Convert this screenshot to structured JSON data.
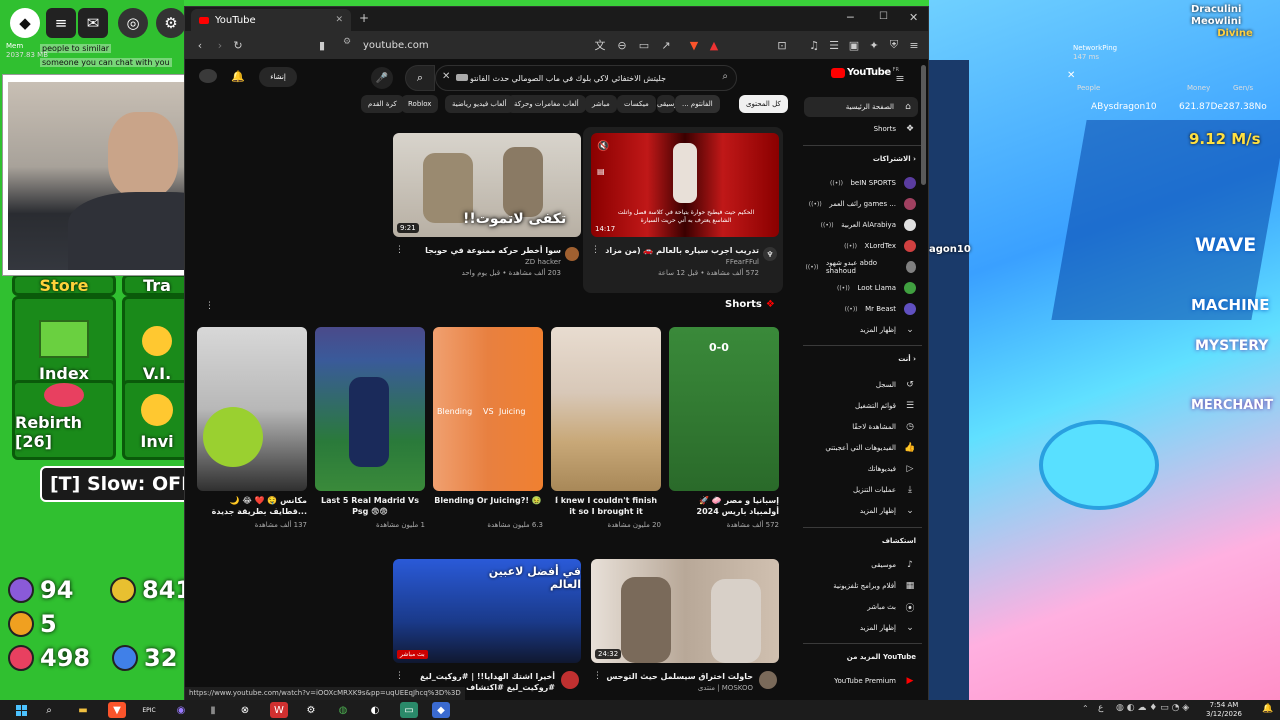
{
  "game": {
    "mem_label": "Mem",
    "mem_value": "2037.83 MB",
    "network_label": "NetworkPing",
    "network_value": "147 ms",
    "chat_line": "people to similar",
    "chat_line2": "someone you can chat with you",
    "tiles": [
      {
        "label": "Store",
        "icon": "store-icon"
      },
      {
        "label": "Tra",
        "icon": "trade-icon"
      },
      {
        "label": "Index",
        "icon": "book-icon"
      },
      {
        "label": "V.I.",
        "icon": "crown-icon"
      },
      {
        "label": "Rebirth [26]",
        "icon": "rebirth-icon"
      },
      {
        "label": "Invi",
        "icon": "invite-icon"
      }
    ],
    "slow_button": "[T] Slow: OFF",
    "stats": [
      {
        "value": "94",
        "color": "#8a5ad8"
      },
      {
        "value": "841",
        "color": "#e8c030"
      },
      {
        "value": "5",
        "color": "#f0a020"
      },
      {
        "value": "498",
        "color": "#e84060"
      },
      {
        "value": "32",
        "color": "#4080e8"
      }
    ],
    "leaderboard": {
      "headers": [
        "People",
        "Money",
        "Gen/s"
      ],
      "player": "ABysdragon10",
      "money": "621.87De",
      "gens": "287.38No",
      "top_name": "Draculini Meowlini",
      "top_sub": "Divine",
      "rate": "9.12 M/s"
    },
    "player_tag": "agon10",
    "signs": [
      "WAVE",
      "MACHINE",
      "MYSTERY",
      "MERCHANT"
    ]
  },
  "browser": {
    "tab_title": "YouTube",
    "new_tab": "+",
    "url": "youtube.com",
    "status_url": "https://www.youtube.com/watch?v=iOOXcMRXK9s&pp=uqUEEqJhcq%3D%3D"
  },
  "youtube": {
    "logo": "YouTube",
    "logo_region": "FR",
    "search_value": "جليتش الاختفائي لاكي بلوك في ماب الصومالي حدث الفانتو",
    "create_label": "إنشاء",
    "chips": [
      "كل المحتوى",
      "... الفانتوم",
      "موسيقى",
      "ميكسات",
      "مباشر",
      "ألعاب مغامرات وحركة",
      "ألعاب فيديو رياضية",
      "Roblox",
      "كرة القدم"
    ],
    "videos_top": [
      {
        "title": "تدريب اجرب سياره بالعالم 🚗 (من مزاد شوتي 🔥)",
        "channel": "FFearFFul",
        "meta": "572 ألف مشاهدة • قبل 12 ساعة",
        "duration": "14:17",
        "thumb_text": "الحكيم حيث فيطبح حوارة بتياحة في كلاسة فصل واتلت الشاسع يعترف به أني حريت السيارة"
      },
      {
        "title": "سوا أخطر حركه ممنوعة في حوبجا",
        "channel": "ZD hacker",
        "meta": "203 ألف مشاهدة • قبل يوم واحد",
        "duration": "9:21",
        "thumb_text": "تكفى لاتموت!!"
      }
    ],
    "shorts_heading": "Shorts",
    "shorts": [
      {
        "title": "إسبانيا و مصر 🧼 🚀 أولمبياد باريس 2024",
        "meta": "572 ألف مشاهدة",
        "overlay": "0-0"
      },
      {
        "title": "I knew I couldn't finish it so I brought it share...",
        "meta": "20 مليون مشاهدة",
        "overlay": ""
      },
      {
        "title": "Blending Or Juicing?! 🤢",
        "meta": "6.3 مليون مشاهدة",
        "overlay_left": "Blending",
        "overlay_mid": "VS",
        "overlay_right": "Juicing"
      },
      {
        "title": "Last 5 Real Madrid Vs Psg 😨😨",
        "meta": "1 مليون مشاهدة",
        "overlay": ""
      },
      {
        "title": "مكانس 🤤 ❤️ 😂 🌙 ...قطايف بطريقة جديدة",
        "meta": "137 ألف مشاهدة",
        "overlay": ""
      }
    ],
    "videos_bottom": [
      {
        "title": "حاولت اختراق سيسلمل حيث التوحس !!",
        "channel": "MOSKOO | منتدى",
        "meta": "",
        "duration": "24:32"
      },
      {
        "title": "أخيرا اشتك الهدايا!! | #روكيت_ليغ #روكيت_ليغ #اكتشاف",
        "channel": "",
        "meta": "",
        "duration": "بث مباشر",
        "thumb_text": "في أفضل لاعبين العالم"
      }
    ],
    "sidebar": {
      "home": "الصفحة الرئيسية",
      "shorts": "Shorts",
      "subs_heading": "الاشتراكات",
      "subs": [
        {
          "name": "beIN SPORTS",
          "color": "#5a3ca0"
        },
        {
          "name": "رائف العمر games ...",
          "color": "#a04060"
        },
        {
          "name": "العربية AlArabiya",
          "color": "#e0e0e0"
        },
        {
          "name": "XLordTex",
          "color": "#d04040"
        },
        {
          "name": "عبدو شهود abdo shahoud",
          "color": "#808080"
        },
        {
          "name": "Loot Llama",
          "color": "#40a040"
        },
        {
          "name": "Mr Beast",
          "color": "#6050c0"
        }
      ],
      "show_more": "إظهار المزيد",
      "you_heading": "أنت",
      "you_items": [
        {
          "label": "السجل",
          "icon": "history-icon"
        },
        {
          "label": "قوائم التشغيل",
          "icon": "playlist-icon"
        },
        {
          "label": "المشاهدة لاحقًا",
          "icon": "clock-icon"
        },
        {
          "label": "الفيديوهات التي أعجبتني",
          "icon": "like-icon"
        },
        {
          "label": "فيديوهاتك",
          "icon": "play-icon"
        },
        {
          "label": "عمليات التنزيل",
          "icon": "download-icon"
        },
        {
          "label": "إظهار المزيد",
          "icon": "chevron-down-icon"
        }
      ],
      "explore_heading": "استكشاف",
      "explore_items": [
        {
          "label": "موسيقى",
          "icon": "music-icon"
        },
        {
          "label": "أفلام وبرامج تلفزيونية",
          "icon": "film-icon"
        },
        {
          "label": "بث مباشر",
          "icon": "live-icon"
        },
        {
          "label": "إظهار المزيد",
          "icon": "chevron-down-icon"
        }
      ],
      "more_heading": "المزيد من YouTube",
      "premium": "YouTube Premium"
    }
  },
  "taskbar": {
    "time": "7:54 AM",
    "date": "3/12/2026",
    "lang": "ع"
  }
}
